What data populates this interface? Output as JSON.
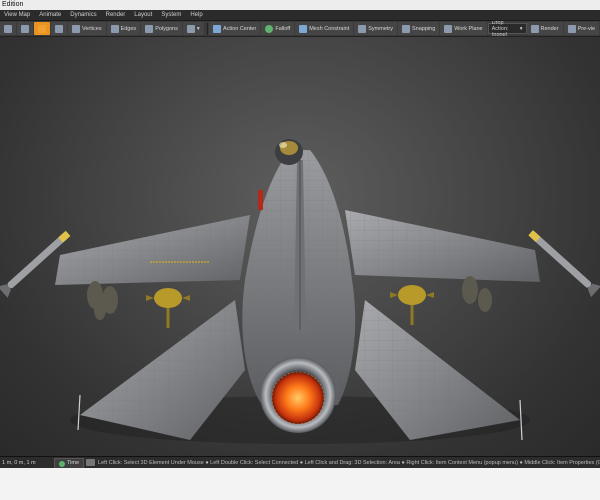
{
  "window": {
    "title": "Edition"
  },
  "menu": {
    "items": [
      "View Map",
      "Animate",
      "Dynamics",
      "Render",
      "Layout",
      "System",
      "Help"
    ]
  },
  "toolbar": {
    "vertices_label": "Vertices",
    "edges_label": "Edges",
    "polygons_label": "Polygons",
    "action_center_label": "Action Center",
    "falloff_label": "Falloff",
    "mesh_constraint_label": "Mesh Constraint",
    "symmetry_label": "Symmetry",
    "snapping_label": "Snapping",
    "work_plane_label": "Work Plane",
    "drop_action_label": "Drop Action: (none)",
    "render_label": "Render",
    "preview_label": "Pre-vie"
  },
  "viewport": {
    "scene": "F-16 fighter jet model rear-top view",
    "colors": {
      "background": "#4a4a4a",
      "fuselage": "#8d8f93",
      "exhaust_glow": "#ff6a1a",
      "missile_tip": "#e0c14a",
      "canopy": "#c9a43a"
    }
  },
  "status": {
    "coords": "1 m, 0 m, 1 m",
    "time_label": "Time",
    "hints": "Left Click: Select 3D Element Under Mouse  ●  Left Double Click: Select Connected  ●  Left Click and Drag: 3D Selection: Area  ●  Right Click: Item Context Menu (popup menu)  ●  Middle Click: Item Properties (Gener"
  }
}
